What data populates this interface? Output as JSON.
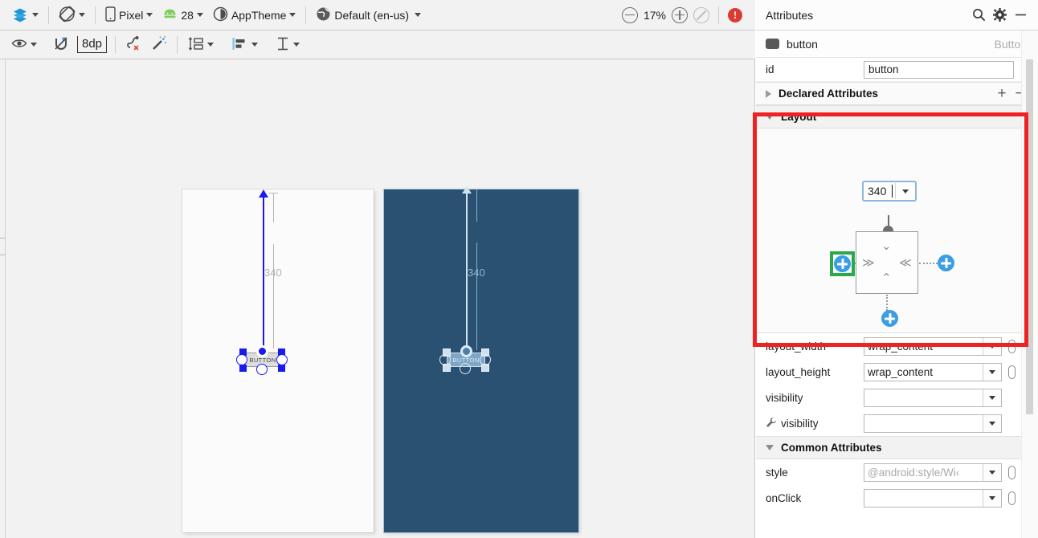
{
  "toolbar_main": {
    "items": [
      {
        "name": "design-surface-mode",
        "icon": "layers-icon",
        "label": ""
      },
      {
        "name": "orientation",
        "icon": "rotate-icon",
        "label": ""
      },
      {
        "name": "device",
        "icon": "phone-icon",
        "label": "Pixel"
      },
      {
        "name": "api-level",
        "icon": "android-icon",
        "label": "28"
      },
      {
        "name": "theme",
        "icon": "theme-contrast-icon",
        "label": "AppTheme"
      },
      {
        "name": "locale",
        "icon": "globe-icon",
        "label": "Default (en-us)"
      }
    ],
    "zoom": {
      "out_label": "zoom-out-icon",
      "level": "17%",
      "in_label": "zoom-in-icon",
      "fit_label": "zoom-fit-icon"
    },
    "issue_badge": "!"
  },
  "toolbar_constraints": {
    "items": [
      {
        "name": "view-options",
        "icon": "eye-icon"
      },
      {
        "name": "autoconnect",
        "icon": "magnet-off-icon"
      },
      {
        "name": "default-margin",
        "icon": "margin-icon",
        "label": "8dp"
      },
      {
        "name": "clear-constraints",
        "icon": "clear-constraints-icon"
      },
      {
        "name": "infer-constraints",
        "icon": "magic-wand-icon"
      },
      {
        "name": "pack",
        "icon": "pack-icon"
      },
      {
        "name": "align",
        "icon": "align-icon"
      },
      {
        "name": "guidelines",
        "icon": "guidelines-icon"
      }
    ]
  },
  "canvas": {
    "design_preview": {
      "name": "design-preview",
      "constraint_value": "340",
      "widget_label": "BUTTON"
    },
    "blueprint_preview": {
      "name": "blueprint-preview",
      "constraint_value": "340",
      "widget_label": "BUTTON",
      "background_color": "#2a5172"
    }
  },
  "attributes": {
    "header": {
      "title": "Attributes",
      "search_icon": "search-icon",
      "settings_icon": "gear-icon",
      "minimize_icon": "minimize-icon"
    },
    "selection": {
      "name": "button",
      "type": "Button"
    },
    "id_row": {
      "label": "id",
      "value": "button"
    },
    "declared_section": {
      "label": "Declared Attributes",
      "add": "+",
      "remove": "−",
      "expanded": false
    },
    "layout_section": {
      "label": "Layout",
      "expanded": true,
      "highlight_color": "#ee2222",
      "widget": {
        "top_margin_value": "340",
        "left_constraint_create": "add-left-constraint",
        "right_constraint_create": "add-right-constraint",
        "bottom_constraint_create": "add-bottom-constraint",
        "highlight_color": "#2aa84a",
        "horizontal_expand": "≫",
        "horizontal_collapse": "≪",
        "vertical_expand_down": "˅˅",
        "vertical_expand_up": "˄˄"
      }
    },
    "fields": [
      {
        "label": "layout_width",
        "value": "wrap_content",
        "placeholder": false,
        "wrench": false,
        "pill": true
      },
      {
        "label": "layout_height",
        "value": "wrap_content",
        "placeholder": false,
        "wrench": false,
        "pill": true
      },
      {
        "label": "visibility",
        "value": "",
        "placeholder": false,
        "wrench": false,
        "pill": false
      },
      {
        "label": "visibility",
        "value": "",
        "placeholder": false,
        "wrench": true,
        "pill": false
      }
    ],
    "common_section": {
      "label": "Common Attributes",
      "expanded": true
    },
    "common_fields": [
      {
        "label": "style",
        "value": "@android:style/Wi‹",
        "placeholder": true,
        "pill": true
      },
      {
        "label": "onClick",
        "value": "",
        "placeholder": false,
        "pill": true
      }
    ]
  }
}
